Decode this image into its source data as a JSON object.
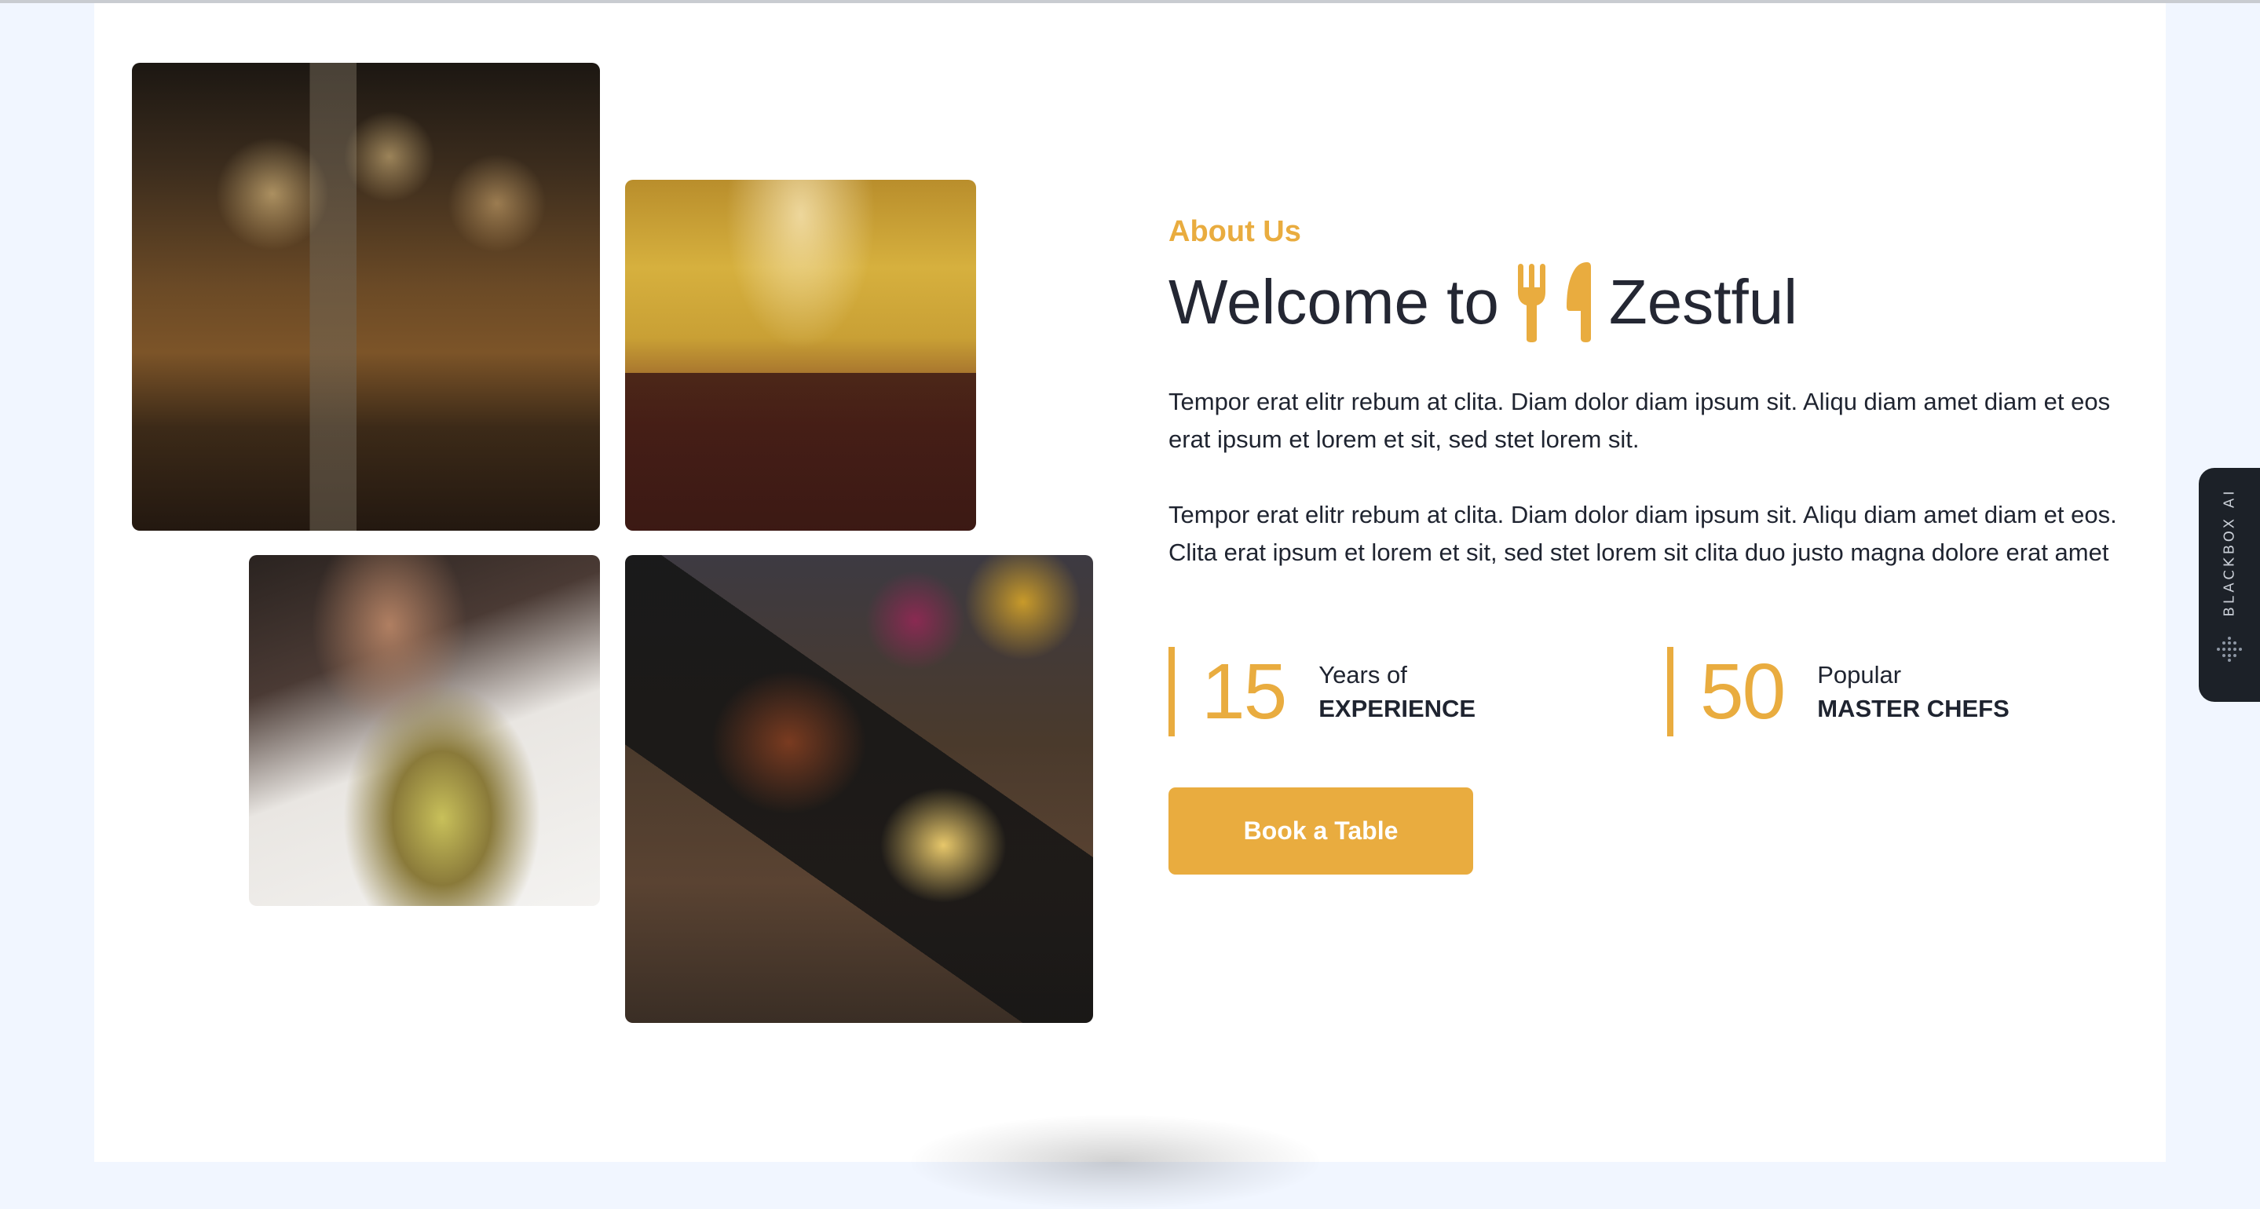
{
  "about": {
    "eyebrow": "About Us",
    "title_prefix": "Welcome to",
    "title_brand": "Zestful",
    "logo_icon": "utensils-icon",
    "paragraphs": [
      "Tempor erat elitr rebum at clita. Diam dolor diam ipsum sit. Aliqu diam amet diam et eos erat ipsum et lorem et sit, sed stet lorem sit.",
      "Tempor erat elitr rebum at clita. Diam dolor diam ipsum sit. Aliqu diam amet diam et eos. Clita erat ipsum et lorem et sit, sed stet lorem sit clita duo justo magna dolore erat amet"
    ],
    "stats": [
      {
        "number": "15",
        "label_line1": "Years of",
        "label_line2": "EXPERIENCE"
      },
      {
        "number": "50",
        "label_line1": "Popular",
        "label_line2": "MASTER CHEFS"
      }
    ],
    "cta_label": "Book a Table"
  },
  "gallery": {
    "images": [
      {
        "name": "restaurant-bar-interior-photo"
      },
      {
        "name": "restaurant-dining-room-photo"
      },
      {
        "name": "salad-plate-photo"
      },
      {
        "name": "grilled-platter-photo"
      }
    ]
  },
  "side_widget": {
    "label": "BLACKBOX AI",
    "icon": "blackbox-dots-icon"
  },
  "colors": {
    "accent": "#e9ac3f",
    "heading": "#242733",
    "page_bg": "#f1f6ff",
    "widget_bg": "#1c2128"
  }
}
